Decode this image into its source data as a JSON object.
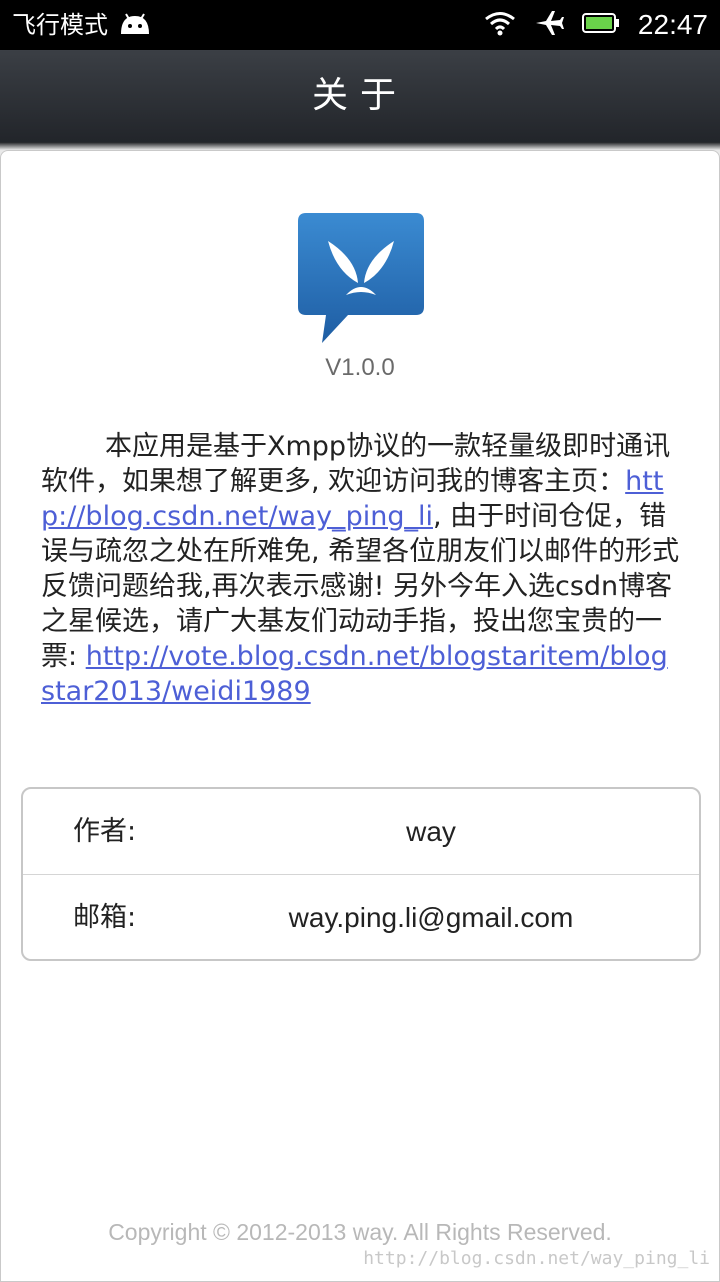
{
  "status_bar": {
    "mode_text": "飞行模式",
    "time": "22:47"
  },
  "header": {
    "title": "关于"
  },
  "about": {
    "version": "V1.0.0",
    "desc": {
      "part1": "本应用是基于Xmpp协议的一款轻量级即时通讯软件，如果想了解更多, 欢迎访问我的博客主页：",
      "link1": "http://blog.csdn.net/way_ping_li",
      "part2": ", 由于时间仓促，错误与疏忽之处在所难免, 希望各位朋友们以邮件的形式反馈问题给我,再次表示感谢! 另外今年入选csdn博客之星候选，请广大基友们动动手指，投出您宝贵的一票: ",
      "link2": "http://vote.blog.csdn.net/blogstaritem/blogstar2013/weidi1989"
    },
    "info": [
      {
        "label": "作者:",
        "value": "way"
      },
      {
        "label": "邮箱:",
        "value": "way.ping.li@gmail.com"
      }
    ],
    "copyright": "Copyright © 2012-2013 way. All Rights Reserved.",
    "watermark": "http://blog.csdn.net/way_ping_li"
  },
  "icons": {
    "status": [
      "android-icon",
      "wifi-icon",
      "airplane-icon",
      "battery-icon"
    ],
    "app": "app-logo-icon"
  },
  "colors": {
    "link": "#4d5fd6",
    "app_icon": "#2a6fb4"
  }
}
